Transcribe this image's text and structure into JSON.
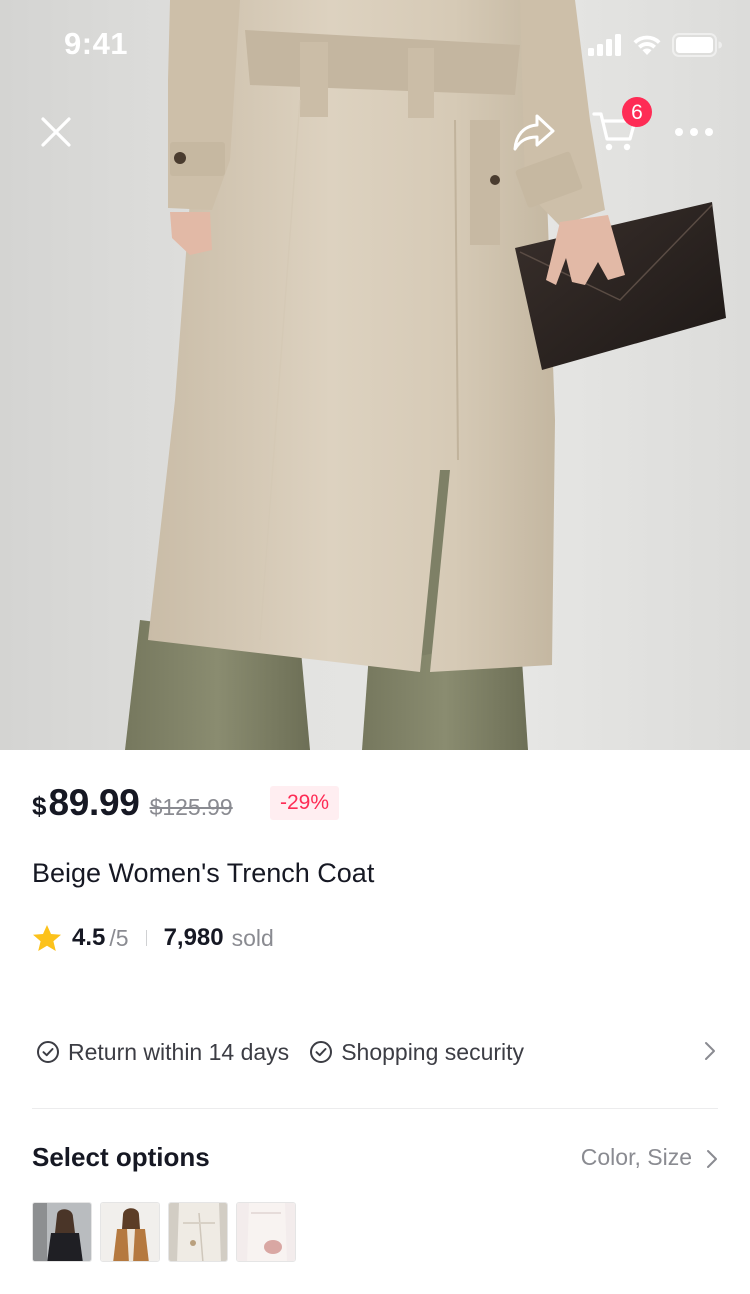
{
  "status_bar": {
    "time": "9:41"
  },
  "nav": {
    "cart_count": "6"
  },
  "product": {
    "currency": "$",
    "price": "89.99",
    "original_price": "$125.99",
    "discount": "-29%",
    "title": "Beige Women's Trench Coat",
    "rating": "4.5",
    "rating_scale": "/5",
    "sold_count": "7,980",
    "sold_label": "sold"
  },
  "policies": [
    {
      "label": "Return within 14 days",
      "icon": "check-circle-icon"
    },
    {
      "label": "Shopping security",
      "icon": "check-circle-icon"
    }
  ],
  "options": {
    "title": "Select options",
    "hint": "Color, Size",
    "variants": [
      {
        "icon": "black-coat-variant"
      },
      {
        "icon": "camel-coat-variant"
      },
      {
        "icon": "white-coat-variant"
      },
      {
        "icon": "cream-coat-variant"
      }
    ]
  },
  "colors": {
    "accent": "#fe2c55",
    "discount_bg": "#ffeef1",
    "text_primary": "#161823",
    "text_secondary": "#8a8b91",
    "star": "#fcc21b"
  }
}
